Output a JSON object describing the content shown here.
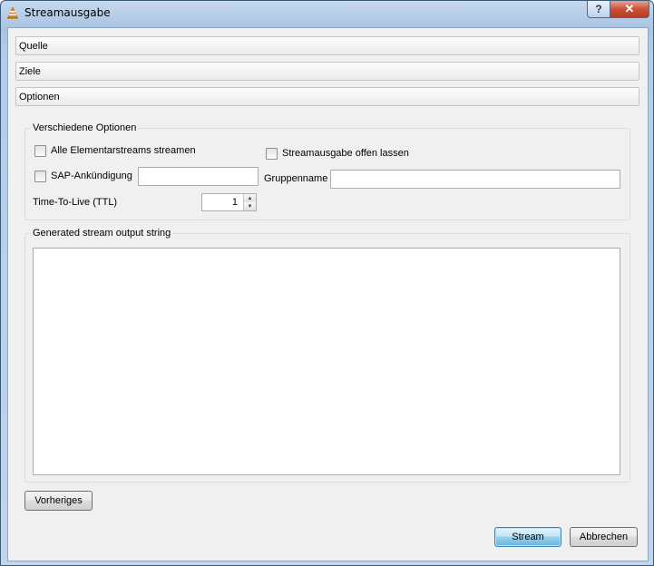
{
  "window": {
    "title": "Streamausgabe",
    "help_label": "?",
    "close_label": "✕"
  },
  "sections": {
    "source": "Quelle",
    "destinations": "Ziele",
    "options": "Optionen"
  },
  "misc_options": {
    "legend": "Verschiedene Optionen",
    "all_es_label": "Alle Elementarstreams streamen",
    "all_es_checked": false,
    "keep_open_label": "Streamausgabe offen lassen",
    "keep_open_checked": false,
    "sap_label": "SAP-Ankündigung",
    "sap_checked": false,
    "sap_value": "",
    "group_label": "Gruppenname",
    "group_value": "",
    "ttl_label": "Time-To-Live (TTL)",
    "ttl_value": "1"
  },
  "output": {
    "legend": "Generated stream output string",
    "value": ""
  },
  "buttons": {
    "previous": "Vorheriges",
    "stream": "Stream",
    "cancel": "Abbrechen"
  },
  "colors": {
    "title_bar": "#b4cce6",
    "client_bg": "#f0f0f0",
    "close_button": "#c9533a",
    "default_button": "#98d1ef"
  },
  "icons": [
    "vlc-cone-icon",
    "help-icon",
    "close-icon",
    "spin-up-icon",
    "spin-down-icon"
  ]
}
